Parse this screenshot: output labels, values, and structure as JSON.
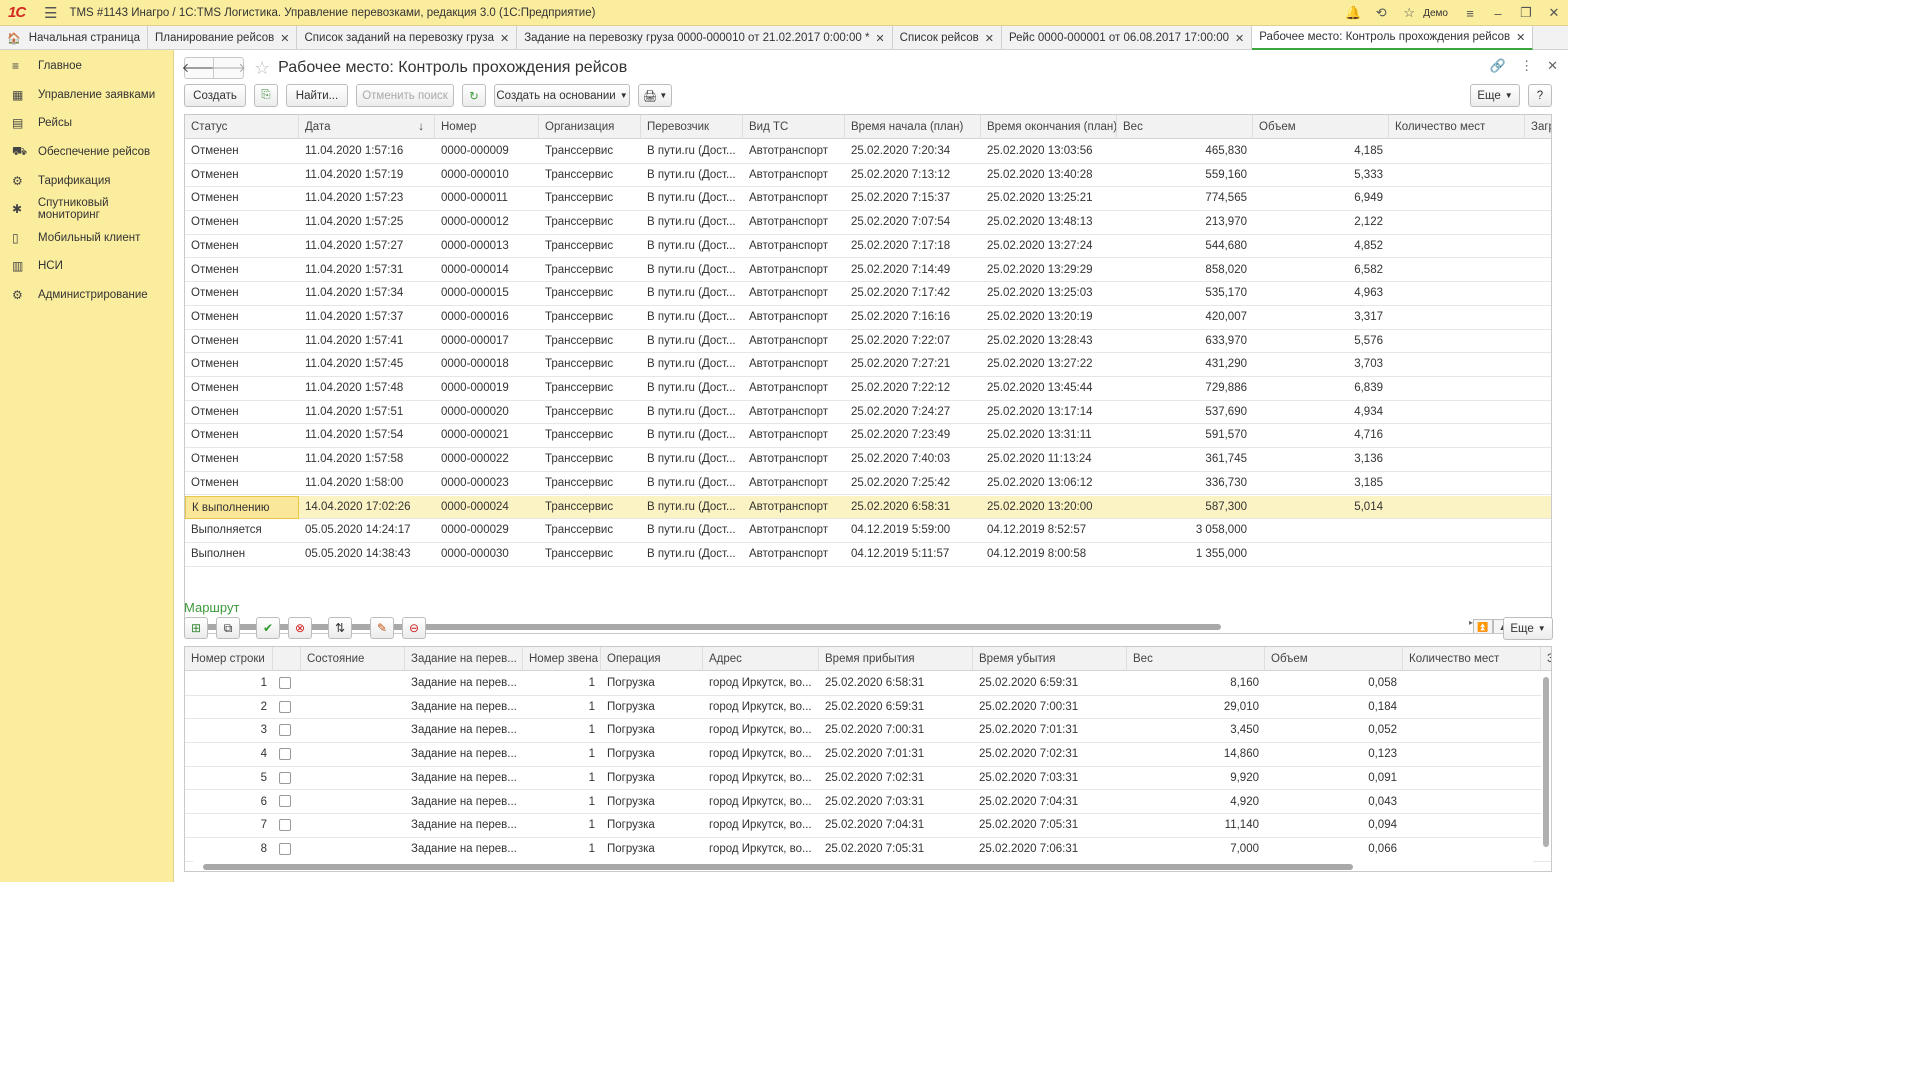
{
  "app": {
    "title": "TMS #1143 Инагро / 1C:TMS Логистика. Управление перевозками, редакция 3.0  (1С:Предприятие)",
    "logo": "1С",
    "user": "Демо"
  },
  "tabs": [
    {
      "label": "Начальная страница",
      "closable": false,
      "active": false
    },
    {
      "label": "Планирование рейсов",
      "closable": true,
      "active": false
    },
    {
      "label": "Список заданий на перевозку груза",
      "closable": true,
      "active": false
    },
    {
      "label": "Задание на перевозку груза 0000-000010 от 21.02.2017 0:00:00 *",
      "closable": true,
      "active": false
    },
    {
      "label": "Список рейсов",
      "closable": true,
      "active": false
    },
    {
      "label": "Рейс 0000-000001 от 06.08.2017 17:00:00",
      "closable": true,
      "active": false
    },
    {
      "label": "Рабочее место: Контроль прохождения рейсов",
      "closable": true,
      "active": true
    }
  ],
  "sidebar": {
    "items": [
      {
        "label": "Главное",
        "icon": "menu-lines-icon"
      },
      {
        "label": "Управление заявками",
        "icon": "grid-icon"
      },
      {
        "label": "Рейсы",
        "icon": "calendar-icon"
      },
      {
        "label": "Обеспечение рейсов",
        "icon": "truck-icon"
      },
      {
        "label": "Тарификация",
        "icon": "tariff-icon"
      },
      {
        "label": "Спутниковый мониторинг",
        "icon": "satellite-icon"
      },
      {
        "label": "Мобильный клиент",
        "icon": "phone-icon"
      },
      {
        "label": "НСИ",
        "icon": "book-icon"
      },
      {
        "label": "Администрирование",
        "icon": "gear-icon"
      }
    ]
  },
  "page": {
    "title": "Рабочее место: Контроль прохождения рейсов"
  },
  "toolbar": {
    "create": "Создать",
    "find": "Найти...",
    "cancel_search": "Отменить поиск",
    "create_based_on": "Создать на основании",
    "more": "Еще",
    "help": "?"
  },
  "trips": {
    "columns": [
      "Статус",
      "Дата",
      "Номер",
      "Организация",
      "Перевозчик",
      "Вид ТС",
      "Время начала (план)",
      "Время окончания (план)",
      "Вес",
      "Объем",
      "Количество мест",
      "Загруз"
    ],
    "sort_indicator": "↓",
    "selected_index": 15,
    "rows": [
      [
        "Отменен",
        "11.04.2020 1:57:16",
        "0000-000009",
        "Транссервис",
        "В пути.ru (Дост...",
        "Автотранспорт",
        "25.02.2020 7:20:34",
        "25.02.2020 13:03:56",
        "465,830",
        "4,185"
      ],
      [
        "Отменен",
        "11.04.2020 1:57:19",
        "0000-000010",
        "Транссервис",
        "В пути.ru (Дост...",
        "Автотранспорт",
        "25.02.2020 7:13:12",
        "25.02.2020 13:40:28",
        "559,160",
        "5,333"
      ],
      [
        "Отменен",
        "11.04.2020 1:57:23",
        "0000-000011",
        "Транссервис",
        "В пути.ru (Дост...",
        "Автотранспорт",
        "25.02.2020 7:15:37",
        "25.02.2020 13:25:21",
        "774,565",
        "6,949"
      ],
      [
        "Отменен",
        "11.04.2020 1:57:25",
        "0000-000012",
        "Транссервис",
        "В пути.ru (Дост...",
        "Автотранспорт",
        "25.02.2020 7:07:54",
        "25.02.2020 13:48:13",
        "213,970",
        "2,122"
      ],
      [
        "Отменен",
        "11.04.2020 1:57:27",
        "0000-000013",
        "Транссервис",
        "В пути.ru (Дост...",
        "Автотранспорт",
        "25.02.2020 7:17:18",
        "25.02.2020 13:27:24",
        "544,680",
        "4,852"
      ],
      [
        "Отменен",
        "11.04.2020 1:57:31",
        "0000-000014",
        "Транссервис",
        "В пути.ru (Дост...",
        "Автотранспорт",
        "25.02.2020 7:14:49",
        "25.02.2020 13:29:29",
        "858,020",
        "6,582"
      ],
      [
        "Отменен",
        "11.04.2020 1:57:34",
        "0000-000015",
        "Транссервис",
        "В пути.ru (Дост...",
        "Автотранспорт",
        "25.02.2020 7:17:42",
        "25.02.2020 13:25:03",
        "535,170",
        "4,963"
      ],
      [
        "Отменен",
        "11.04.2020 1:57:37",
        "0000-000016",
        "Транссервис",
        "В пути.ru (Дост...",
        "Автотранспорт",
        "25.02.2020 7:16:16",
        "25.02.2020 13:20:19",
        "420,007",
        "3,317"
      ],
      [
        "Отменен",
        "11.04.2020 1:57:41",
        "0000-000017",
        "Транссервис",
        "В пути.ru (Дост...",
        "Автотранспорт",
        "25.02.2020 7:22:07",
        "25.02.2020 13:28:43",
        "633,970",
        "5,576"
      ],
      [
        "Отменен",
        "11.04.2020 1:57:45",
        "0000-000018",
        "Транссервис",
        "В пути.ru (Дост...",
        "Автотранспорт",
        "25.02.2020 7:27:21",
        "25.02.2020 13:27:22",
        "431,290",
        "3,703"
      ],
      [
        "Отменен",
        "11.04.2020 1:57:48",
        "0000-000019",
        "Транссервис",
        "В пути.ru (Дост...",
        "Автотранспорт",
        "25.02.2020 7:22:12",
        "25.02.2020 13:45:44",
        "729,886",
        "6,839"
      ],
      [
        "Отменен",
        "11.04.2020 1:57:51",
        "0000-000020",
        "Транссервис",
        "В пути.ru (Дост...",
        "Автотранспорт",
        "25.02.2020 7:24:27",
        "25.02.2020 13:17:14",
        "537,690",
        "4,934"
      ],
      [
        "Отменен",
        "11.04.2020 1:57:54",
        "0000-000021",
        "Транссервис",
        "В пути.ru (Дост...",
        "Автотранспорт",
        "25.02.2020 7:23:49",
        "25.02.2020 13:31:11",
        "591,570",
        "4,716"
      ],
      [
        "Отменен",
        "11.04.2020 1:57:58",
        "0000-000022",
        "Транссервис",
        "В пути.ru (Дост...",
        "Автотранспорт",
        "25.02.2020 7:40:03",
        "25.02.2020 11:13:24",
        "361,745",
        "3,136"
      ],
      [
        "Отменен",
        "11.04.2020 1:58:00",
        "0000-000023",
        "Транссервис",
        "В пути.ru (Дост...",
        "Автотранспорт",
        "25.02.2020 7:25:42",
        "25.02.2020 13:06:12",
        "336,730",
        "3,185"
      ],
      [
        "К выполнению",
        "14.04.2020 17:02:26",
        "0000-000024",
        "Транссервис",
        "В пути.ru (Дост...",
        "Автотранспорт",
        "25.02.2020 6:58:31",
        "25.02.2020 13:20:00",
        "587,300",
        "5,014"
      ],
      [
        "Выполняется",
        "05.05.2020 14:24:17",
        "0000-000029",
        "Транссервис",
        "В пути.ru (Дост...",
        "Автотранспорт",
        "04.12.2019 5:59:00",
        "04.12.2019 8:52:57",
        "3 058,000",
        ""
      ],
      [
        "Выполнен",
        "05.05.2020 14:38:43",
        "0000-000030",
        "Транссервис",
        "В пути.ru (Дост...",
        "Автотранспорт",
        "04.12.2019 5:11:57",
        "04.12.2019 8:00:58",
        "1 355,000",
        ""
      ]
    ]
  },
  "route": {
    "title": "Маршрут",
    "more": "Еще",
    "columns": [
      "Номер строки",
      "",
      "Состояние",
      "Задание на перев...",
      "Номер звена",
      "Операция",
      "Адрес",
      "Время прибытия",
      "Время убытия",
      "Вес",
      "Объем",
      "Количество мест",
      "За"
    ],
    "rows": [
      [
        "1",
        "",
        "",
        "Задание на перев...",
        "1",
        "Погрузка",
        "город Иркутск, во...",
        "25.02.2020 6:58:31",
        "25.02.2020 6:59:31",
        "8,160",
        "0,058"
      ],
      [
        "2",
        "",
        "",
        "Задание на перев...",
        "1",
        "Погрузка",
        "город Иркутск, во...",
        "25.02.2020 6:59:31",
        "25.02.2020 7:00:31",
        "29,010",
        "0,184"
      ],
      [
        "3",
        "",
        "",
        "Задание на перев...",
        "1",
        "Погрузка",
        "город Иркутск, во...",
        "25.02.2020 7:00:31",
        "25.02.2020 7:01:31",
        "3,450",
        "0,052"
      ],
      [
        "4",
        "",
        "",
        "Задание на перев...",
        "1",
        "Погрузка",
        "город Иркутск, во...",
        "25.02.2020 7:01:31",
        "25.02.2020 7:02:31",
        "14,860",
        "0,123"
      ],
      [
        "5",
        "",
        "",
        "Задание на перев...",
        "1",
        "Погрузка",
        "город Иркутск, во...",
        "25.02.2020 7:02:31",
        "25.02.2020 7:03:31",
        "9,920",
        "0,091"
      ],
      [
        "6",
        "",
        "",
        "Задание на перев...",
        "1",
        "Погрузка",
        "город Иркутск, во...",
        "25.02.2020 7:03:31",
        "25.02.2020 7:04:31",
        "4,920",
        "0,043"
      ],
      [
        "7",
        "",
        "",
        "Задание на перев...",
        "1",
        "Погрузка",
        "город Иркутск, во...",
        "25.02.2020 7:04:31",
        "25.02.2020 7:05:31",
        "11,140",
        "0,094"
      ],
      [
        "8",
        "",
        "",
        "Задание на перев...",
        "1",
        "Погрузка",
        "город Иркутск, во...",
        "25.02.2020 7:05:31",
        "25.02.2020 7:06:31",
        "7,000",
        "0,066"
      ]
    ]
  }
}
